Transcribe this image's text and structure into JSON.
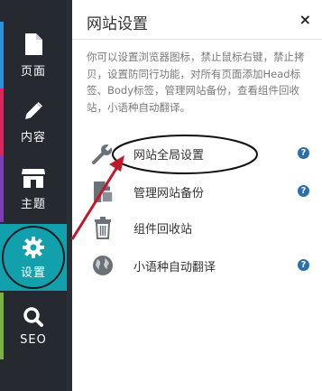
{
  "sidebar": {
    "items": [
      {
        "label": "页面",
        "icon": "page-icon",
        "stripe": "#2f8fd8"
      },
      {
        "label": "内容",
        "icon": "pencil-icon",
        "stripe": "#d6285b"
      },
      {
        "label": "主题",
        "icon": "store-icon",
        "stripe": "#7c3fb6"
      },
      {
        "label": "设置",
        "icon": "gear-icon",
        "stripe": "#13a0ad"
      },
      {
        "label": "SEO",
        "icon": "search-icon",
        "stripe": "#7cb342"
      }
    ]
  },
  "panel": {
    "title": "网站设置",
    "close": "×",
    "description": "你可以设置浏览器图标，禁止鼠标右键，禁止拷贝，设置防同行功能，对所有页面添加Head标签、Body标签，管理网站备份，查看组件回收站，小语种自动翻译。",
    "items": [
      {
        "label": "网站全局设置",
        "icon": "wrench-icon"
      },
      {
        "label": "管理网站备份",
        "icon": "backup-icon"
      },
      {
        "label": "组件回收站",
        "icon": "trash-icon"
      },
      {
        "label": "小语种自动翻译",
        "icon": "globe-icon"
      }
    ],
    "help": "?"
  },
  "colors": {
    "accent": "#13a0ad",
    "annotation": "#c0182a"
  }
}
